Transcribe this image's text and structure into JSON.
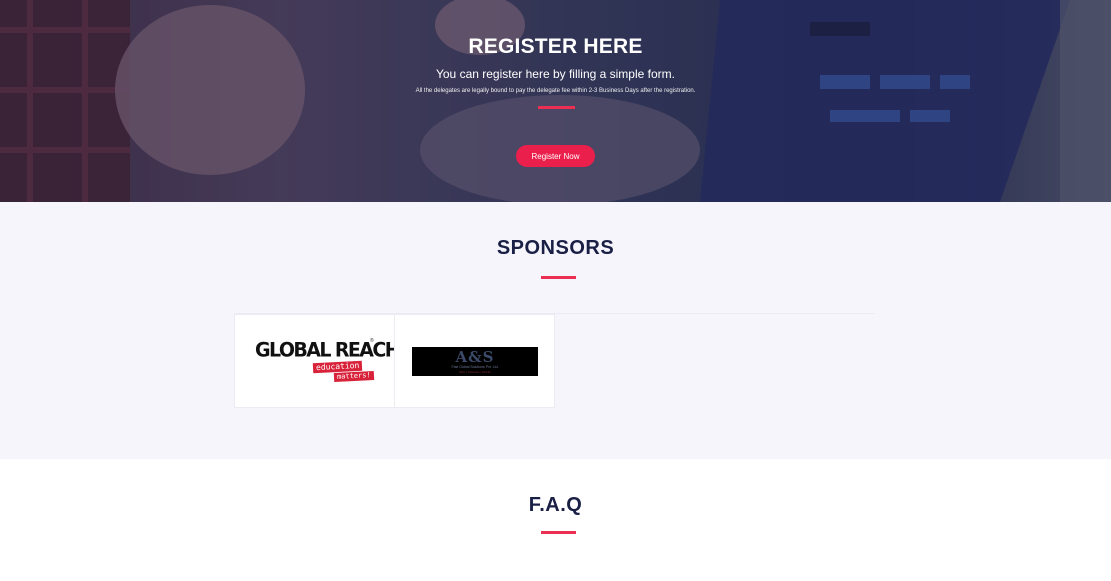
{
  "hero": {
    "title": "REGISTER HERE",
    "subtitle": "You can register here by filling a simple form.",
    "note": "All the delegates are legally bound to pay the delegate fee within 2-3 Business Days after the registration.",
    "button_label": "Register Now"
  },
  "sponsors": {
    "title": "SPONSORS",
    "items": [
      {
        "logo_text": "GLOBAL REACH",
        "reg_mark": "®",
        "tagline_1": "education",
        "tagline_2": "matters!"
      },
      {
        "logo_text": "A&S",
        "subtext": "Fast Global Solutions Pvt. Ltd.",
        "subtext_2": "Web | Software | Mobile"
      }
    ]
  },
  "faq": {
    "title": "F.A.Q"
  },
  "colors": {
    "accent": "#ea2f52",
    "button": "#ea1f4b",
    "heading": "#1a1f45",
    "section_bg": "#f5f5fb"
  }
}
